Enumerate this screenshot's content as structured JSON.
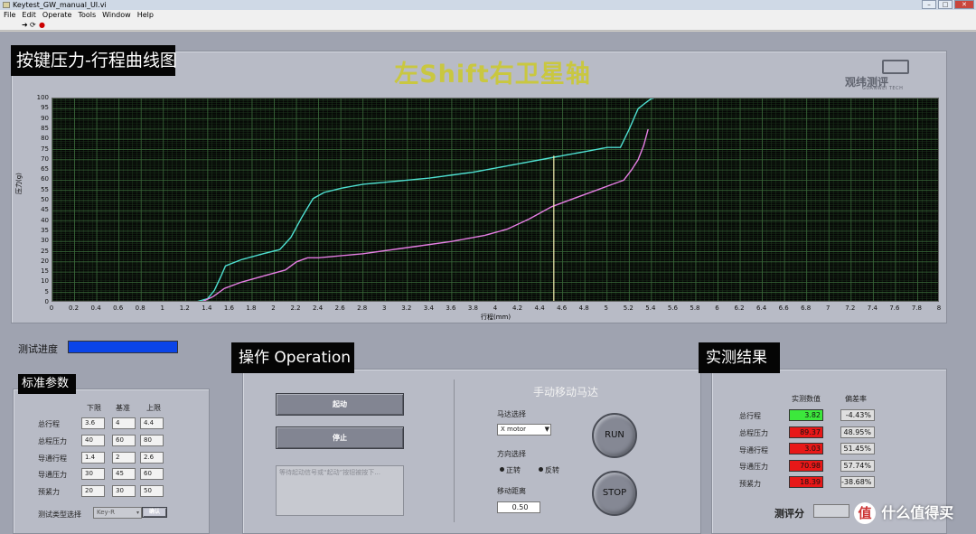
{
  "window": {
    "title": "Keytest_GW_manual_UI.vi",
    "menu": [
      "File",
      "Edit",
      "Operate",
      "Tools",
      "Window",
      "Help"
    ]
  },
  "chart_section": {
    "label": "按键压力-行程曲线图",
    "title": "左Shift右卫星轴",
    "logo_text": "观纬测评",
    "logo_sub": "GUANWEI TECH"
  },
  "chart_data": {
    "type": "line",
    "xlabel": "行程(mm)",
    "ylabel": "压力(g)",
    "xlim": [
      0,
      8
    ],
    "ylim": [
      0,
      100
    ],
    "x_ticks": [
      "0",
      "0.2",
      "0.4",
      "0.6",
      "0.8",
      "1",
      "1.2",
      "1.4",
      "1.6",
      "1.8",
      "2",
      "2.2",
      "2.4",
      "2.6",
      "2.8",
      "3",
      "3.2",
      "3.4",
      "3.6",
      "3.8",
      "4",
      "4.2",
      "4.4",
      "4.6",
      "4.8",
      "5",
      "5.2",
      "5.4",
      "5.6",
      "5.8",
      "6",
      "6.2",
      "6.4",
      "6.6",
      "6.8",
      "7",
      "7.2",
      "7.4",
      "7.6",
      "7.8",
      "8"
    ],
    "y_ticks": [
      "0",
      "5",
      "10",
      "15",
      "20",
      "25",
      "30",
      "35",
      "40",
      "45",
      "50",
      "55",
      "60",
      "65",
      "70",
      "75",
      "80",
      "85",
      "90",
      "95",
      "100"
    ],
    "grid": true,
    "background": "#050505",
    "cursor_x": 4.52,
    "series": [
      {
        "color": "#4fe0d2",
        "x": [
          0,
          1.3,
          1.4,
          1.46,
          1.52,
          1.56,
          1.7,
          1.9,
          2.05,
          2.15,
          2.25,
          2.35,
          2.45,
          2.6,
          2.8,
          3.0,
          3.4,
          3.8,
          4.2,
          4.5,
          4.8,
          5.0,
          5.12,
          5.2,
          5.28,
          5.35,
          5.4,
          5.42
        ],
        "y": [
          0.5,
          0.5,
          2,
          6,
          13,
          18,
          21,
          24,
          26,
          32,
          42,
          51,
          54,
          56,
          58,
          59,
          61,
          64,
          68,
          71,
          74,
          76,
          76,
          85,
          95,
          98,
          100,
          100
        ]
      },
      {
        "color": "#e57ee3",
        "x": [
          0,
          1.35,
          1.45,
          1.55,
          1.7,
          1.9,
          2.1,
          2.2,
          2.3,
          2.4,
          2.8,
          3.2,
          3.6,
          3.9,
          4.1,
          4.3,
          4.5,
          4.7,
          4.9,
          5.05,
          5.15,
          5.22,
          5.28,
          5.33,
          5.37
        ],
        "y": [
          0.5,
          0.5,
          3,
          7,
          10,
          13,
          16,
          20,
          22,
          22,
          24,
          27,
          30,
          33,
          36,
          41,
          47,
          51,
          55,
          58,
          60,
          65,
          70,
          77,
          85
        ]
      },
      {
        "color": "#e03030",
        "x": [
          1.4,
          5.4
        ],
        "y": [
          0.3,
          0.3
        ]
      }
    ]
  },
  "progress": {
    "label": "测试进度",
    "value": 1.0,
    "fill_color": "#0a44e8"
  },
  "standards": {
    "label": "标准参数",
    "columns": [
      "下限",
      "基准",
      "上限"
    ],
    "rows": [
      {
        "name": "总行程",
        "values": [
          "3.6",
          "4",
          "4.4"
        ]
      },
      {
        "name": "总程压力",
        "values": [
          "40",
          "60",
          "80"
        ]
      },
      {
        "name": "导通行程",
        "values": [
          "1.4",
          "2",
          "2.6"
        ]
      },
      {
        "name": "导通压力",
        "values": [
          "30",
          "45",
          "60"
        ]
      },
      {
        "name": "预紧力",
        "values": [
          "20",
          "30",
          "50"
        ]
      }
    ],
    "type_label": "测试类型选择",
    "type_value": "Key-R",
    "type_button": "确认"
  },
  "operation": {
    "label": "操作 Operation",
    "start_button": "起动",
    "stop_button": "停止",
    "message": "等待起动信号或“起动”按钮被按下..."
  },
  "manual_motor": {
    "title": "手动移动马达",
    "motor_select_label": "马达选择",
    "motor_select_value": "X motor",
    "direction_label": "方向选择",
    "dir_forward": "正转",
    "dir_reverse": "反转",
    "distance_label": "移动距离",
    "distance_value": "0.50",
    "run_button": "RUN",
    "stop_button": "STOP"
  },
  "results": {
    "label": "实测结果",
    "columns": [
      "实测数值",
      "偏差率"
    ],
    "rows": [
      {
        "name": "总行程",
        "value": "3.82",
        "deviation": "-4.43%",
        "color": "#3ce83c"
      },
      {
        "name": "总程压力",
        "value": "89.37",
        "deviation": "48.95%",
        "color": "#e81818"
      },
      {
        "name": "导通行程",
        "value": "3.03",
        "deviation": "51.45%",
        "color": "#e81818"
      },
      {
        "name": "导通压力",
        "value": "70.98",
        "deviation": "57.74%",
        "color": "#e81818"
      },
      {
        "name": "预紧力",
        "value": "18.39",
        "deviation": "-38.68%",
        "color": "#e81818"
      }
    ],
    "score_label": "测评分"
  },
  "watermark": "值 什么值得买"
}
